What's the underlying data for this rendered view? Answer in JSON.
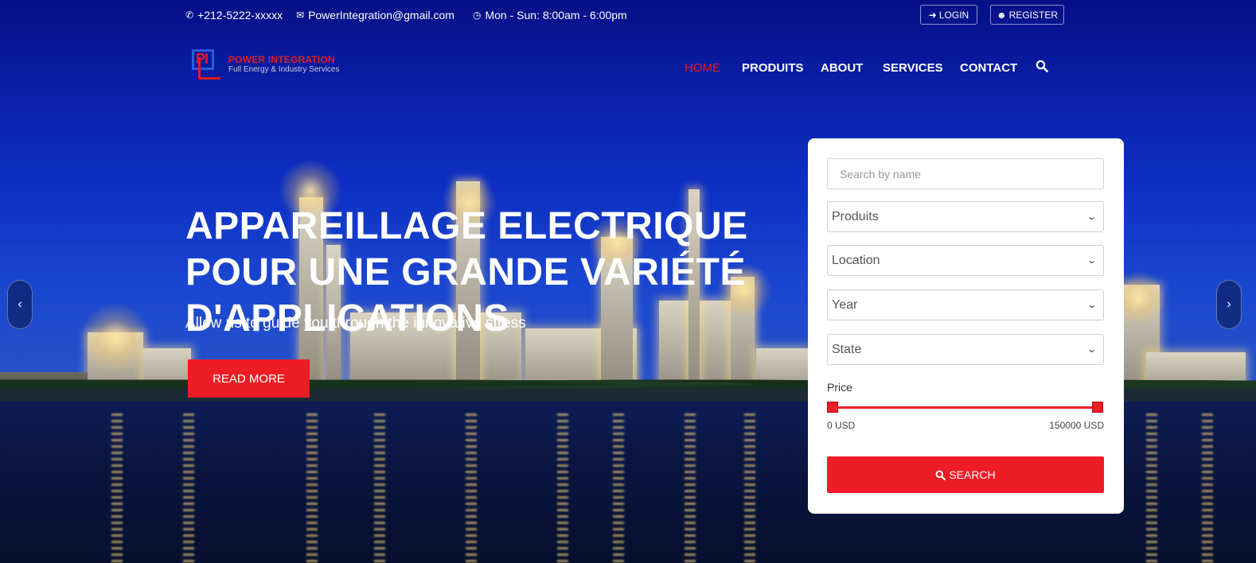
{
  "topbar": {
    "phone": "+212-5222-xxxxx",
    "email": "PowerIntegration@gmail.com",
    "hours": "Mon - Sun: 8:00am - 6:00pm",
    "login_label": "LOGIN",
    "register_label": "REGISTER"
  },
  "logo": {
    "mark": "PI",
    "name": "POWER INTEGRATION",
    "tagline": "Full Energy & Industry Services"
  },
  "nav": {
    "items": [
      {
        "label": "HOME",
        "active": true
      },
      {
        "label": "PRODUITS"
      },
      {
        "label": "ABOUT"
      },
      {
        "label": "SERVICES"
      },
      {
        "label": "CONTACT"
      }
    ],
    "search_icon": "search-icon"
  },
  "hero": {
    "title": "APPAREILLAGE ELECTRIQUE POUR UNE GRANDE VARIÉTÉ\nD'APPLICATIONS",
    "subtitle": "Allow us to guide you through the innovative stress",
    "button_label": "READ MORE"
  },
  "carousel": {
    "prev_icon": "chevron-left-icon",
    "next_icon": "chevron-right-icon"
  },
  "search_panel": {
    "name_placeholder": "Search by name",
    "selects": [
      {
        "value": "Produits"
      },
      {
        "value": "Location"
      },
      {
        "value": "Year"
      },
      {
        "value": "State"
      }
    ],
    "price_label": "Price",
    "price_min": "0 USD",
    "price_max": "150000 USD",
    "price_range_fraction": [
      0,
      1
    ],
    "button_label": "SEARCH"
  },
  "colors": {
    "accent": "#ee1c25",
    "sky": "#0a1fa8",
    "panel_bg": "#ffffff"
  }
}
